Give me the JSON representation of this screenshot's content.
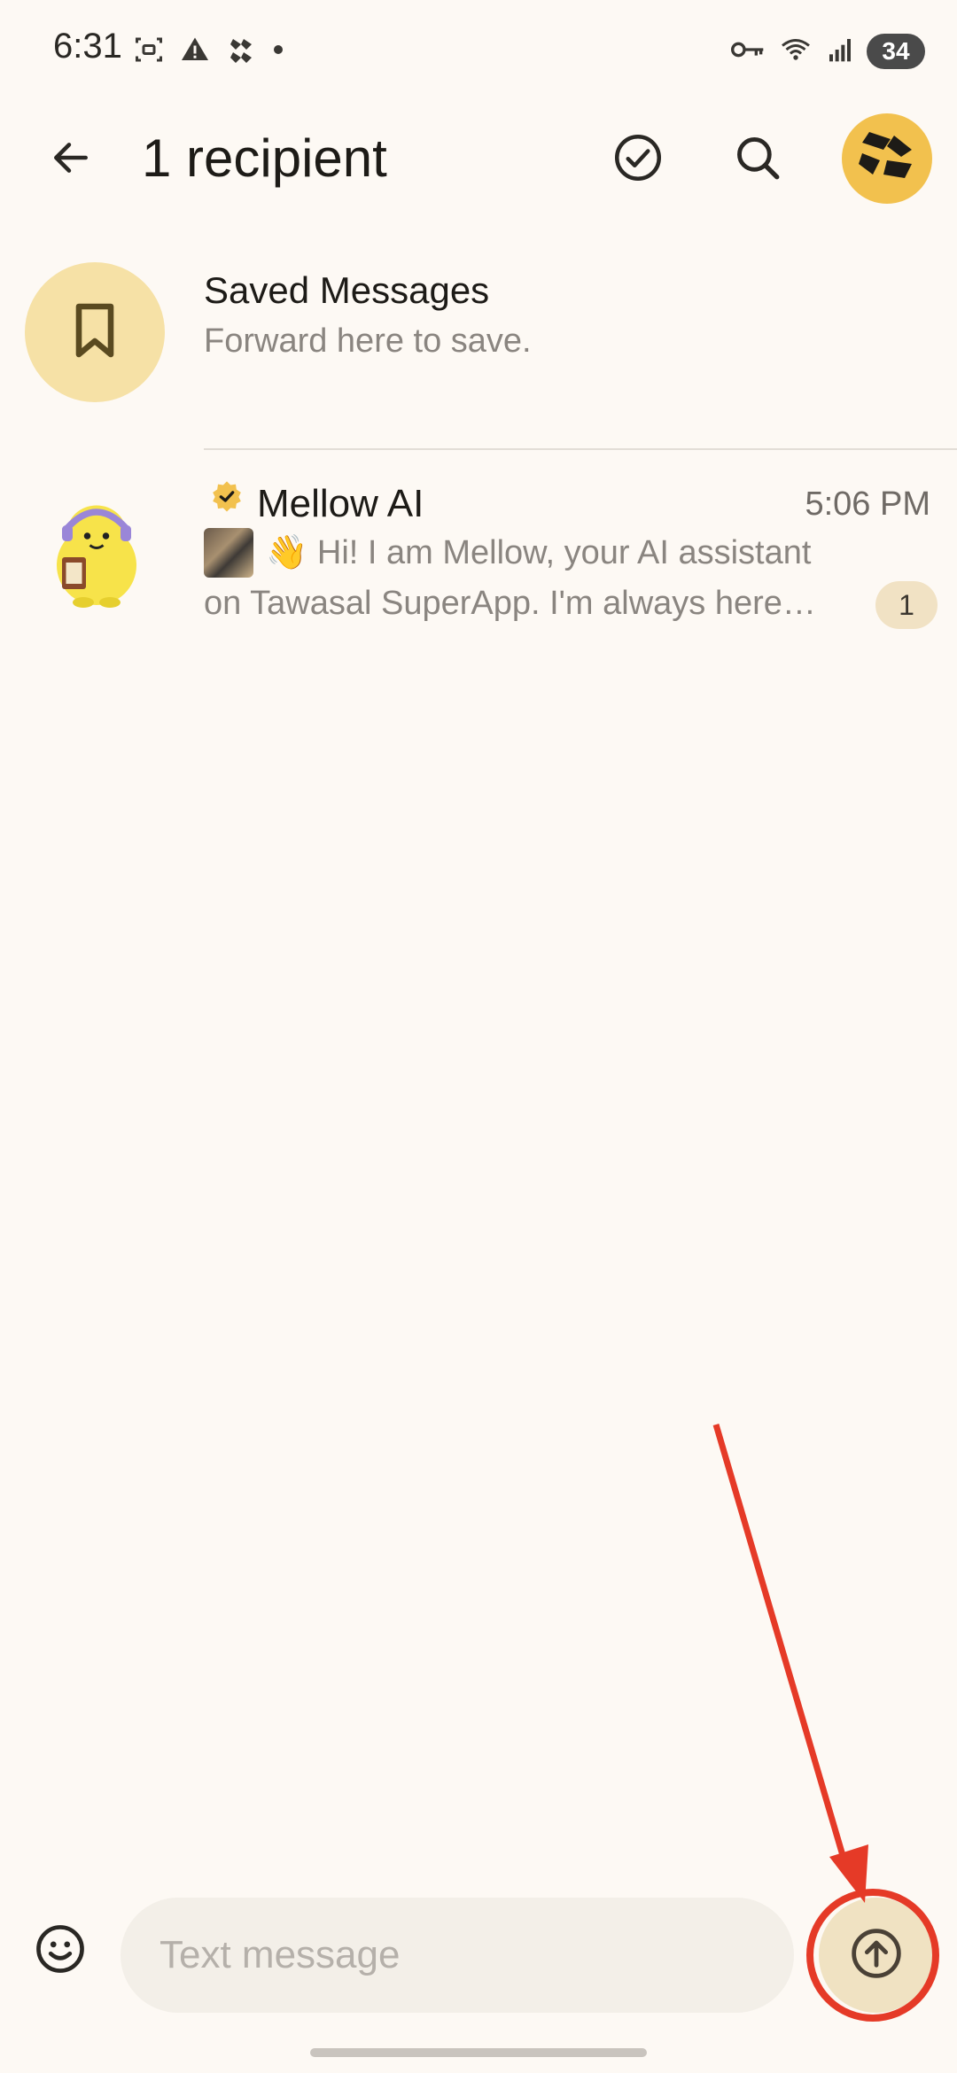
{
  "status_bar": {
    "time": "6:31",
    "battery": "34",
    "left_icons": [
      "screen-record-icon",
      "alert-icon",
      "app-logo-icon",
      "dot-icon"
    ],
    "right_icons": [
      "vpn-key-icon",
      "wifi-icon",
      "signal-icon"
    ]
  },
  "app_bar": {
    "title": "1 recipient",
    "icons": [
      "back-arrow-icon",
      "check-circle-icon",
      "search-icon"
    ]
  },
  "chats": [
    {
      "title": "Saved Messages",
      "subtitle": "Forward here to save.",
      "icon": "bookmark-icon"
    },
    {
      "title": "Mellow AI",
      "time": "5:06 PM",
      "preview_line1": "👋 Hi! I am Mellow, your AI assistant",
      "preview_line2": "on Tawasal SuperApp.  I'm always here…",
      "unread": "1",
      "verified": true
    }
  ],
  "composer": {
    "placeholder": "Text message",
    "icons": [
      "emoji-icon",
      "send-arrow-icon"
    ]
  },
  "colors": {
    "background": "#fdf9f4",
    "accent": "#f2c14e",
    "annotation": "#e53a27"
  }
}
